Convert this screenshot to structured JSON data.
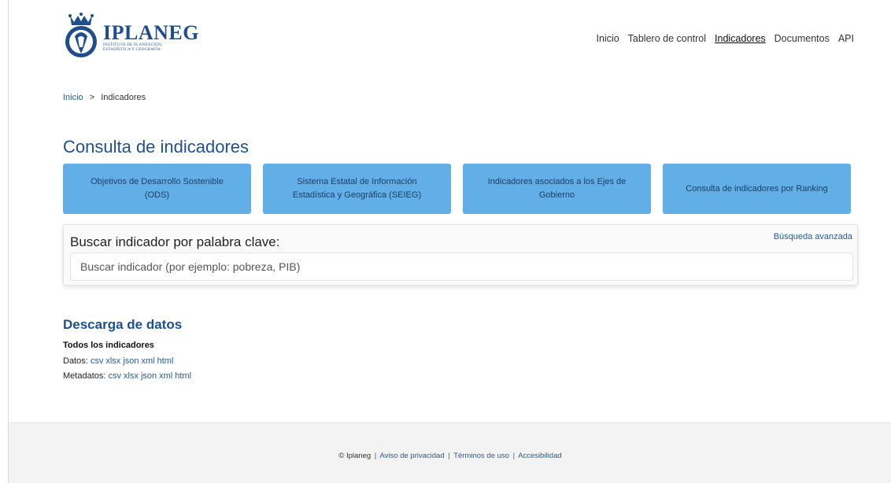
{
  "brand": {
    "name": "IPLANEG",
    "subtitle": "INSTITUTO DE PLANEACIÓN, ESTADÍSTICA Y GEOGRAFÍA",
    "color": "#1f4e8c"
  },
  "nav": {
    "items": [
      {
        "label": "Inicio"
      },
      {
        "label": "Tablero de control"
      },
      {
        "label": "Indicadores",
        "active": true
      },
      {
        "label": "Documentos"
      },
      {
        "label": "API"
      }
    ]
  },
  "breadcrumb": {
    "home": "Inicio",
    "separator": ">",
    "current": "Indicadores"
  },
  "page": {
    "title": "Consulta de indicadores"
  },
  "cards": [
    {
      "label": "Objetivos de Desarrollo Sostenible (ODS)"
    },
    {
      "label": "Sistema Estatal de Información Estadística y Geográfica (SEIEG)"
    },
    {
      "label": "Indicadores asociados a los Ejes de Gobierno"
    },
    {
      "label": "Consulta de indicadores por Ranking"
    }
  ],
  "search": {
    "title": "Buscar indicador por palabra clave:",
    "advanced_link": "Búsqueda avanzada",
    "placeholder": "Buscar indicador (por ejemplo: pobreza, PIB)",
    "value": ""
  },
  "downloads": {
    "title": "Descarga de datos",
    "subtitle": "Todos los indicadores",
    "data_label": "Datos:",
    "metadata_label": "Metadatos:",
    "formats": [
      "csv",
      "xlsx",
      "json",
      "xml",
      "html"
    ]
  },
  "footer": {
    "copyright": "© Iplaneg",
    "separator": "|",
    "links": [
      "Aviso de privacidad",
      "Términos de uso",
      "Accesibilidad"
    ]
  },
  "colors": {
    "accent": "#1e5191",
    "card_bg": "#62aee6",
    "link": "#1f5c9e"
  }
}
